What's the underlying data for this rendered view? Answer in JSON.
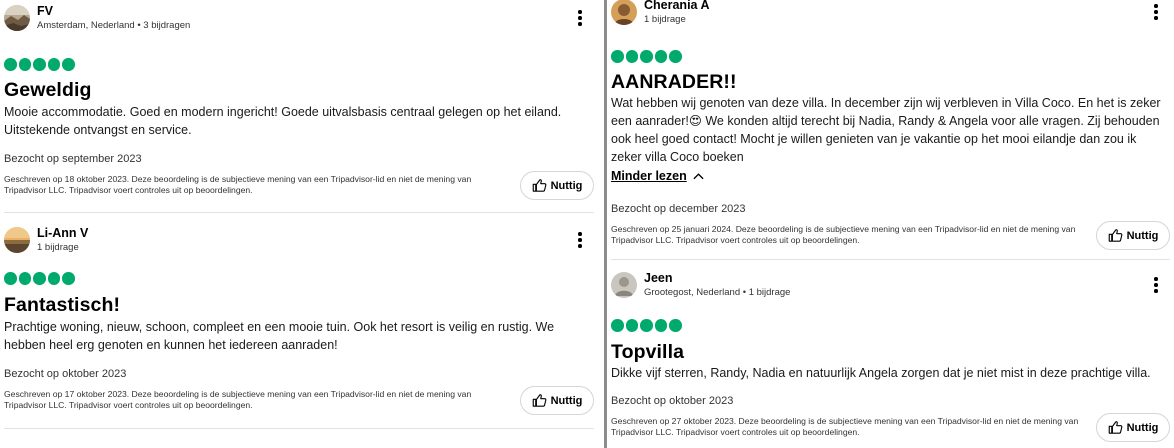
{
  "reviews": [
    {
      "name": "FV",
      "meta": "Amsterdam, Nederland • 3 bijdragen",
      "avatar_icon": "avatar-landscape",
      "rating": 5,
      "title": "Geweldig",
      "body": "Mooie accommodatie. Goed en modern ingericht! Goede uitvalsbasis centraal gelegen op het eiland. Uitstekende ontvangst en service.",
      "visited": "Bezocht op september 2023",
      "disclaimer": "Geschreven op 18 oktober 2023. Deze beoordeling is de subjectieve mening van een Tripadvisor-lid en niet de mening van Tripadvisor LLC. Tripadvisor voert controles uit op beoordelingen.",
      "helpful_label": "Nuttig"
    },
    {
      "name": "Li-Ann V",
      "meta": "1 bijdrage",
      "avatar_icon": "avatar-sunset",
      "rating": 5,
      "title": "Fantastisch!",
      "body": "Prachtige woning, nieuw, schoon, compleet en een mooie tuin. Ook het resort is veilig en rustig. We hebben heel erg genoten en kunnen het iedereen aanraden!",
      "visited": "Bezocht op oktober 2023",
      "disclaimer": "Geschreven op 17 oktober 2023. Deze beoordeling is de subjectieve mening van een Tripadvisor-lid en niet de mening van Tripadvisor LLC. Tripadvisor voert controles uit op beoordelingen.",
      "helpful_label": "Nuttig"
    },
    {
      "name": "Cherania A",
      "meta": "1 bijdrage",
      "avatar_icon": "avatar-portrait",
      "rating": 5,
      "title": "AANRADER!!",
      "body": "Wat hebben wij genoten van deze villa. In december zijn wij verbleven in Villa Coco. En het is zeker een aanrader!😍 We konden altijd terecht bij Nadia, Randy & Angela voor alle vragen. Zij behouden ook heel goed contact! Mocht je willen genieten van je vakantie op het mooi eilandje dan zou ik zeker villa Coco boeken",
      "read_less": "Minder lezen",
      "visited": "Bezocht op december 2023",
      "disclaimer": "Geschreven op 25 januari 2024. Deze beoordeling is de subjectieve mening van een Tripadvisor-lid en niet de mening van Tripadvisor LLC. Tripadvisor voert controles uit op beoordelingen.",
      "helpful_label": "Nuttig"
    },
    {
      "name": "Jeen",
      "meta": "Grootegost, Nederland • 1 bijdrage",
      "avatar_icon": "avatar-default",
      "rating": 5,
      "title": "Topvilla",
      "body": "Dikke vijf sterren, Randy, Nadia en natuurlijk Angela zorgen dat je niet mist in deze prachtige villa.",
      "visited": "Bezocht op oktober 2023",
      "disclaimer": "Geschreven op 27 oktober 2023. Deze beoordeling is de subjectieve mening van een Tripadvisor-lid en niet de mening van Tripadvisor LLC. Tripadvisor voert controles uit op beoordelingen.",
      "helpful_label": "Nuttig"
    }
  ],
  "colors": {
    "bubble": "#00aa6c",
    "divider": "#8c8c8c"
  }
}
